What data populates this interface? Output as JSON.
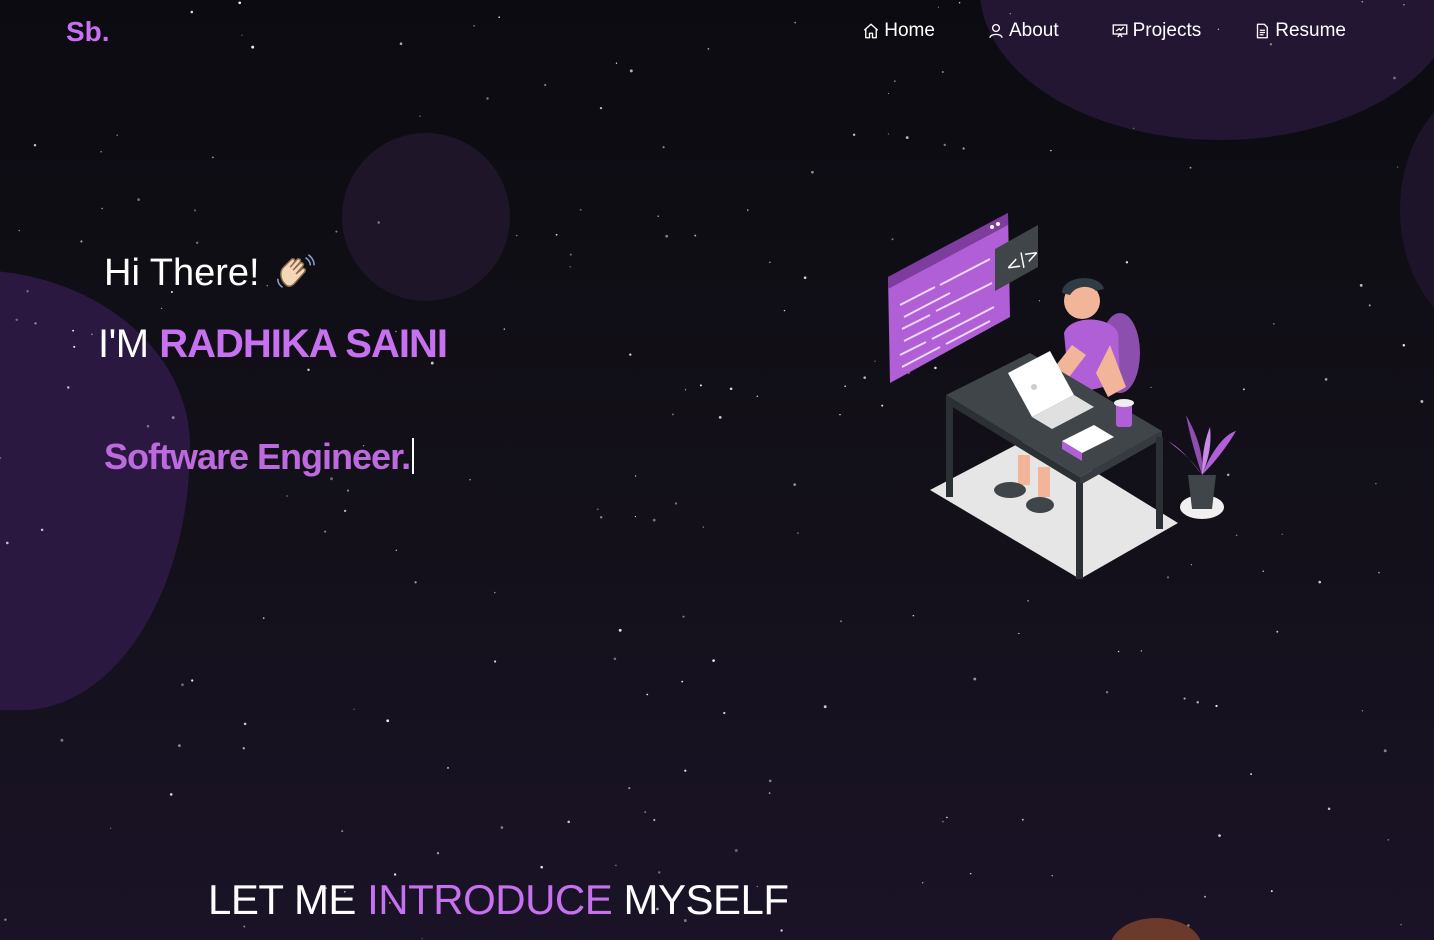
{
  "colors": {
    "accent": "#c770f0",
    "background": "#0c0b11",
    "text": "#ffffff"
  },
  "header": {
    "logo": "Sb."
  },
  "nav": {
    "items": [
      {
        "label": "Home",
        "icon": "home-icon"
      },
      {
        "label": "About",
        "icon": "user-icon"
      },
      {
        "label": "Projects",
        "icon": "projects-icon"
      },
      {
        "label": "Resume",
        "icon": "document-icon"
      }
    ]
  },
  "hero": {
    "greeting": "Hi There!",
    "greeting_icon": "waving-hand-icon",
    "name_prefix": "I'M",
    "name": "RADHIKA SAINI",
    "role": "Software Engineer.",
    "illustration": "developer-at-desk-illustration"
  },
  "intro": {
    "part1": "LET ME",
    "highlight": "INTRODUCE",
    "part2": "MYSELF"
  }
}
